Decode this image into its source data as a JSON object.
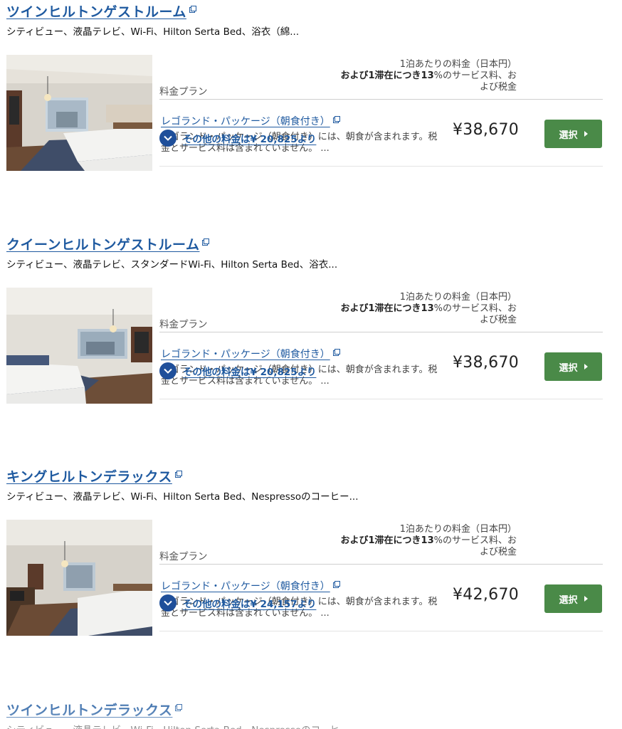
{
  "rooms": [
    {
      "title": "ツインヒルトンゲストルーム",
      "amenities": "シティビュー、液晶テレビ、Wi-Fi、Hilton Serta Bed、浴衣（綿...",
      "plan_header": "料金プラン",
      "price_header_line1": "1泊あたりの料金（日本円）",
      "price_header_line2_bold": "および1滞在につき13",
      "price_header_line2_rest": "%のサービス料、お",
      "price_header_line3": "よび税金",
      "plan_name": "レゴランド・パッケージ（朝食付き）",
      "plan_desc": "レゴランド・パッケージ（朝食付き）には、朝食が含まれます。税金とサービス料は含まれていません。 ...",
      "price": "¥38,670",
      "select_label": "選択",
      "more_rates": "その他の料金は¥ 20,825より"
    },
    {
      "title": "クイーンヒルトンゲストルーム",
      "amenities": "シティビュー、液晶テレビ、スタンダードWi-Fi、Hilton Serta Bed、浴衣...",
      "plan_header": "料金プラン",
      "price_header_line1": "1泊あたりの料金（日本円）",
      "price_header_line2_bold": "および1滞在につき13",
      "price_header_line2_rest": "%のサービス料、お",
      "price_header_line3": "よび税金",
      "plan_name": "レゴランド・パッケージ（朝食付き）",
      "plan_desc": "レゴランド・パッケージ（朝食付き）には、朝食が含まれます。税金とサービス料は含まれていません。 ...",
      "price": "¥38,670",
      "select_label": "選択",
      "more_rates": "その他の料金は¥ 20,825より"
    },
    {
      "title": "キングヒルトンデラックス",
      "amenities": "シティビュー、液晶テレビ、Wi-Fi、Hilton Serta Bed、Nespressoのコーヒー...",
      "plan_header": "料金プラン",
      "price_header_line1": "1泊あたりの料金（日本円）",
      "price_header_line2_bold": "および1滞在につき13",
      "price_header_line2_rest": "%のサービス料、お",
      "price_header_line3": "よび税金",
      "plan_name": "レゴランド・パッケージ（朝食付き）",
      "plan_desc": "レゴランド・パッケージ（朝食付き）には、朝食が含まれます。税金とサービス料は含まれていません。 ...",
      "price": "¥42,670",
      "select_label": "選択",
      "more_rates": "その他の料金は¥ 24,157より"
    },
    {
      "title": "ツインヒルトンデラックス",
      "amenities": "シティビュー、液晶テレビ、Wi-Fi、Hilton Serta Bed、Nespressoのコーヒー..."
    }
  ],
  "colors": {
    "link": "#1f5aa0",
    "select_button": "#4a8a48",
    "chevron_circle": "#1f4f9a"
  },
  "icons": {
    "external": "external-link-icon",
    "chevron": "chevron-down-icon",
    "caret": "caret-right-icon"
  }
}
